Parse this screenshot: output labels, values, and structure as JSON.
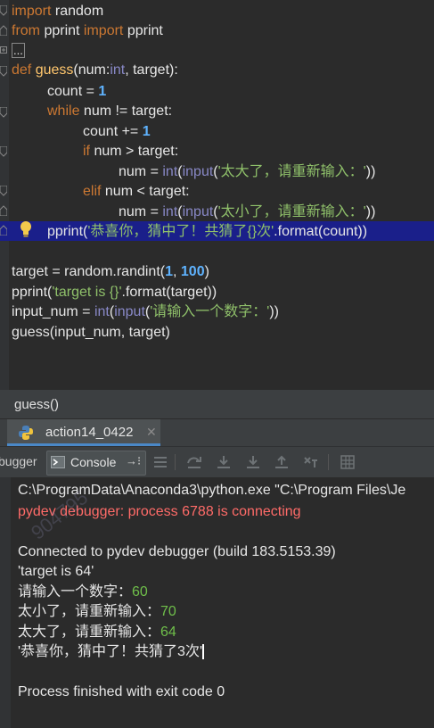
{
  "editor": {
    "lines": {
      "l1a": "import",
      "l1b": " random",
      "l2a": "from",
      "l2b": " pprint ",
      "l2c": "import",
      "l2d": " pprint",
      "l3": "...",
      "l4a": "def",
      "l4b": " ",
      "l4c": "guess",
      "l4d": "(num:",
      "l4e": "int",
      "l4f": ", target):",
      "l5a": "count = ",
      "l5b": "1",
      "l6a": "while",
      "l6b": " num != target:",
      "l7a": "count += ",
      "l7b": "1",
      "l8a": "if",
      "l8b": " num > target:",
      "l9a": "num = ",
      "l9b": "int",
      "l9c": "(",
      "l9d": "input",
      "l9e": "(",
      "l9f": "'太大了，请重新输入：'",
      "l9g": "))",
      "l10a": "elif",
      "l10b": " num < target:",
      "l11a": "num = ",
      "l11b": "int",
      "l11c": "(",
      "l11d": "input",
      "l11e": "(",
      "l11f": "'太小了，请重新输入：'",
      "l11g": "))",
      "l12a": "pprint(",
      "l12b": "'恭喜你，猜中了！共猜了{}次'",
      "l12c": ".format(count))",
      "l13a": "target = random.randint(",
      "l13b": "1",
      "l13c": ", ",
      "l13d": "100",
      "l13e": ")",
      "l14a": "pprint(",
      "l14b": "'target is {}'",
      "l14c": ".format(target))",
      "l15a": "input_num = ",
      "l15b": "int",
      "l15c": "(",
      "l15d": "input",
      "l15e": "(",
      "l15f": "'请输入一个数字：'",
      "l15g": "))",
      "l16": "guess(input_num, target)"
    },
    "breadcrumb": "guess()"
  },
  "run_panel": {
    "tab_label": "action14_0422",
    "toolbar": {
      "debugger_label": "bugger",
      "console_label": "Console"
    },
    "console_lines": {
      "c1": "C:\\ProgramData\\Anaconda3\\python.exe \"C:\\Program Files\\Je",
      "c2": "pydev debugger: process 6788 is connecting",
      "c3": "Connected to pydev debugger (build 183.5153.39)",
      "c4": "'target is 64'",
      "c5a": "请输入一个数字：",
      "c5b": "60",
      "c6a": "太小了，请重新输入：",
      "c6b": "70",
      "c7a": "太大了，请重新输入：",
      "c7b": "64",
      "c8": "'恭喜你，猜中了！共猜了3次'",
      "c9": "Process finished with exit code 0"
    },
    "watermark": "904795"
  },
  "colors": {
    "background": "#2b2b2b",
    "keyword": "#cc7832",
    "function": "#ffc66d",
    "number": "#5fb3ff",
    "string": "#6a8759",
    "highlight": "#1a1f8a",
    "error": "#ff6b68",
    "input": "#6fbf4a"
  }
}
